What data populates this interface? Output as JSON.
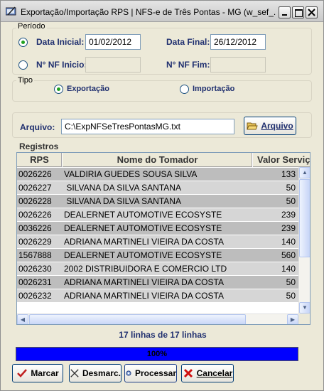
{
  "window": {
    "title": "Exportação/Importação RPS  |  NFS-e de Três Pontas - MG (w_sef_..."
  },
  "periodo": {
    "group_label": "Período",
    "data_inicial_label": "Data Inicial:",
    "data_inicial_value": "01/02/2012",
    "data_final_label": "Data Final:",
    "data_final_value": "26/12/2012",
    "nf_inicio_label": "N° NF Inicio:",
    "nf_inicio_value": "",
    "nf_fim_label": "N° NF Fim:",
    "nf_fim_value": ""
  },
  "tipo": {
    "group_label": "Tipo",
    "exportacao_label": "Exportação",
    "importacao_label": "Importação",
    "selected": "Exportação"
  },
  "arquivo": {
    "label": "Arquivo:",
    "value": "C:\\ExpNFSeTresPontasMG.txt",
    "button_label": "Arquivo"
  },
  "registros": {
    "group_label": "Registros",
    "columns": [
      "RPS",
      "Nome do Tomador",
      "Valor Serviç"
    ],
    "rows": [
      {
        "rps": "0026226",
        "nome": "VALDIRIA GUEDES SOUSA SILVA",
        "valor": "133"
      },
      {
        "rps": "0026227",
        "nome": " SILVANA DA SILVA SANTANA",
        "valor": "50"
      },
      {
        "rps": "0026228",
        "nome": " SILVANA DA SILVA SANTANA",
        "valor": "50"
      },
      {
        "rps": "0026226",
        "nome": "DEALERNET AUTOMOTIVE ECOSYSTE",
        "valor": "239"
      },
      {
        "rps": "0036226",
        "nome": "DEALERNET AUTOMOTIVE ECOSYSTE",
        "valor": "239"
      },
      {
        "rps": "0026229",
        "nome": "ADRIANA MARTINELI VIEIRA DA COSTA",
        "valor": "140"
      },
      {
        "rps": "1567888",
        "nome": "DEALERNET AUTOMOTIVE ECOSYSTE",
        "valor": "560"
      },
      {
        "rps": "0026230",
        "nome": "2002 DISTRIBUIDORA E COMERCIO LTD",
        "valor": "140"
      },
      {
        "rps": "0026231",
        "nome": "ADRIANA MARTINELI VIEIRA DA COSTA",
        "valor": "50"
      },
      {
        "rps": "0026232",
        "nome": "ADRIANA MARTINELI VIEIRA DA COSTA",
        "valor": "50"
      }
    ],
    "count_text": "17 linhas de 17 linhas"
  },
  "progress": {
    "percent": 100,
    "text": "100%"
  },
  "buttons": {
    "marcar": "Marcar",
    "desmarcar": "Desmarc.",
    "processar": "Processar",
    "cancelar": "Cancelar"
  },
  "colors": {
    "progress_fill": "#0000ff",
    "label_blue": "#1f2f6f",
    "row_dark": "#bdbdbd",
    "row_light": "#d6d6d6"
  }
}
